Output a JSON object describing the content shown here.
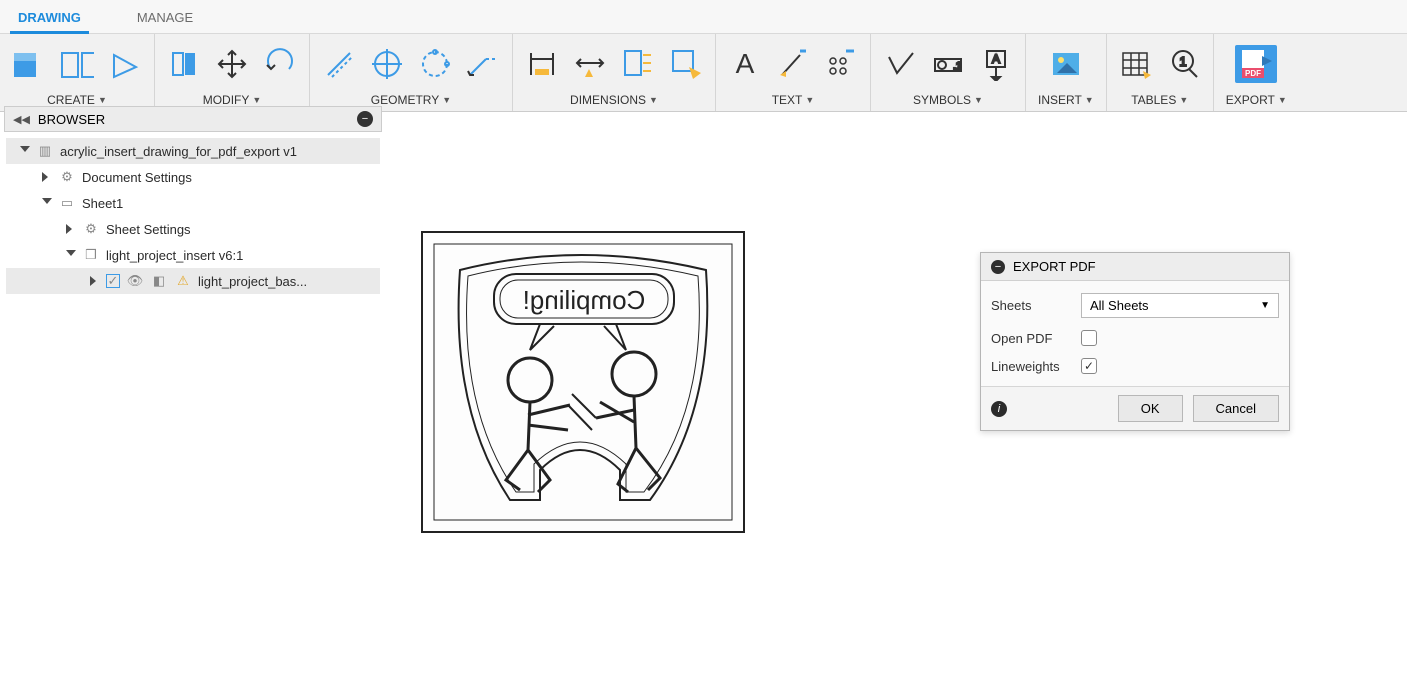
{
  "tabs": {
    "drawing": "DRAWING",
    "manage": "MANAGE"
  },
  "ribbon": {
    "create": "CREATE",
    "modify": "MODIFY",
    "geometry": "GEOMETRY",
    "dimensions": "DIMENSIONS",
    "text": "TEXT",
    "symbols": "SYMBOLS",
    "insert": "INSERT",
    "tables": "TABLES",
    "export": "EXPORT"
  },
  "browser": {
    "title": "BROWSER",
    "root": "acrylic_insert_drawing_for_pdf_export v1",
    "docSettings": "Document Settings",
    "sheet": "Sheet1",
    "sheetSettings": "Sheet Settings",
    "component": "light_project_insert v6:1",
    "body": "light_project_bas..."
  },
  "exportPanel": {
    "title": "EXPORT PDF",
    "sheetsLabel": "Sheets",
    "sheetsValue": "All Sheets",
    "openPdf": "Open PDF",
    "lineweights": "Lineweights",
    "ok": "OK",
    "cancel": "Cancel"
  },
  "drawing": {
    "bubble": "Compiling!"
  }
}
